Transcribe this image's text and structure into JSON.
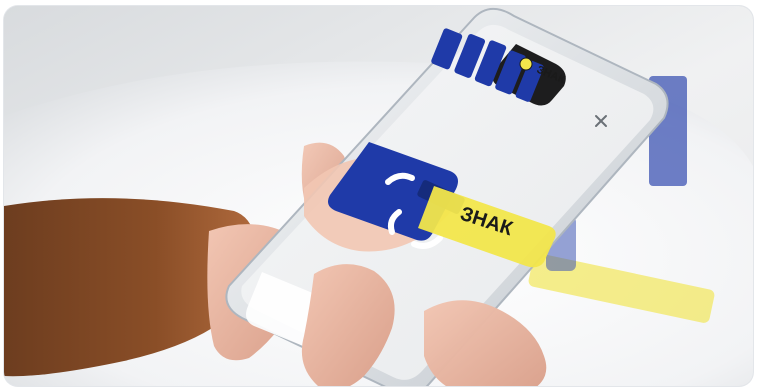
{
  "photo": {
    "phone_brand_text": "ЗНАК",
    "box_label_text": "ЗНАК",
    "accent_color": "#f2e64b",
    "product_blue": "#1f3aa8"
  }
}
